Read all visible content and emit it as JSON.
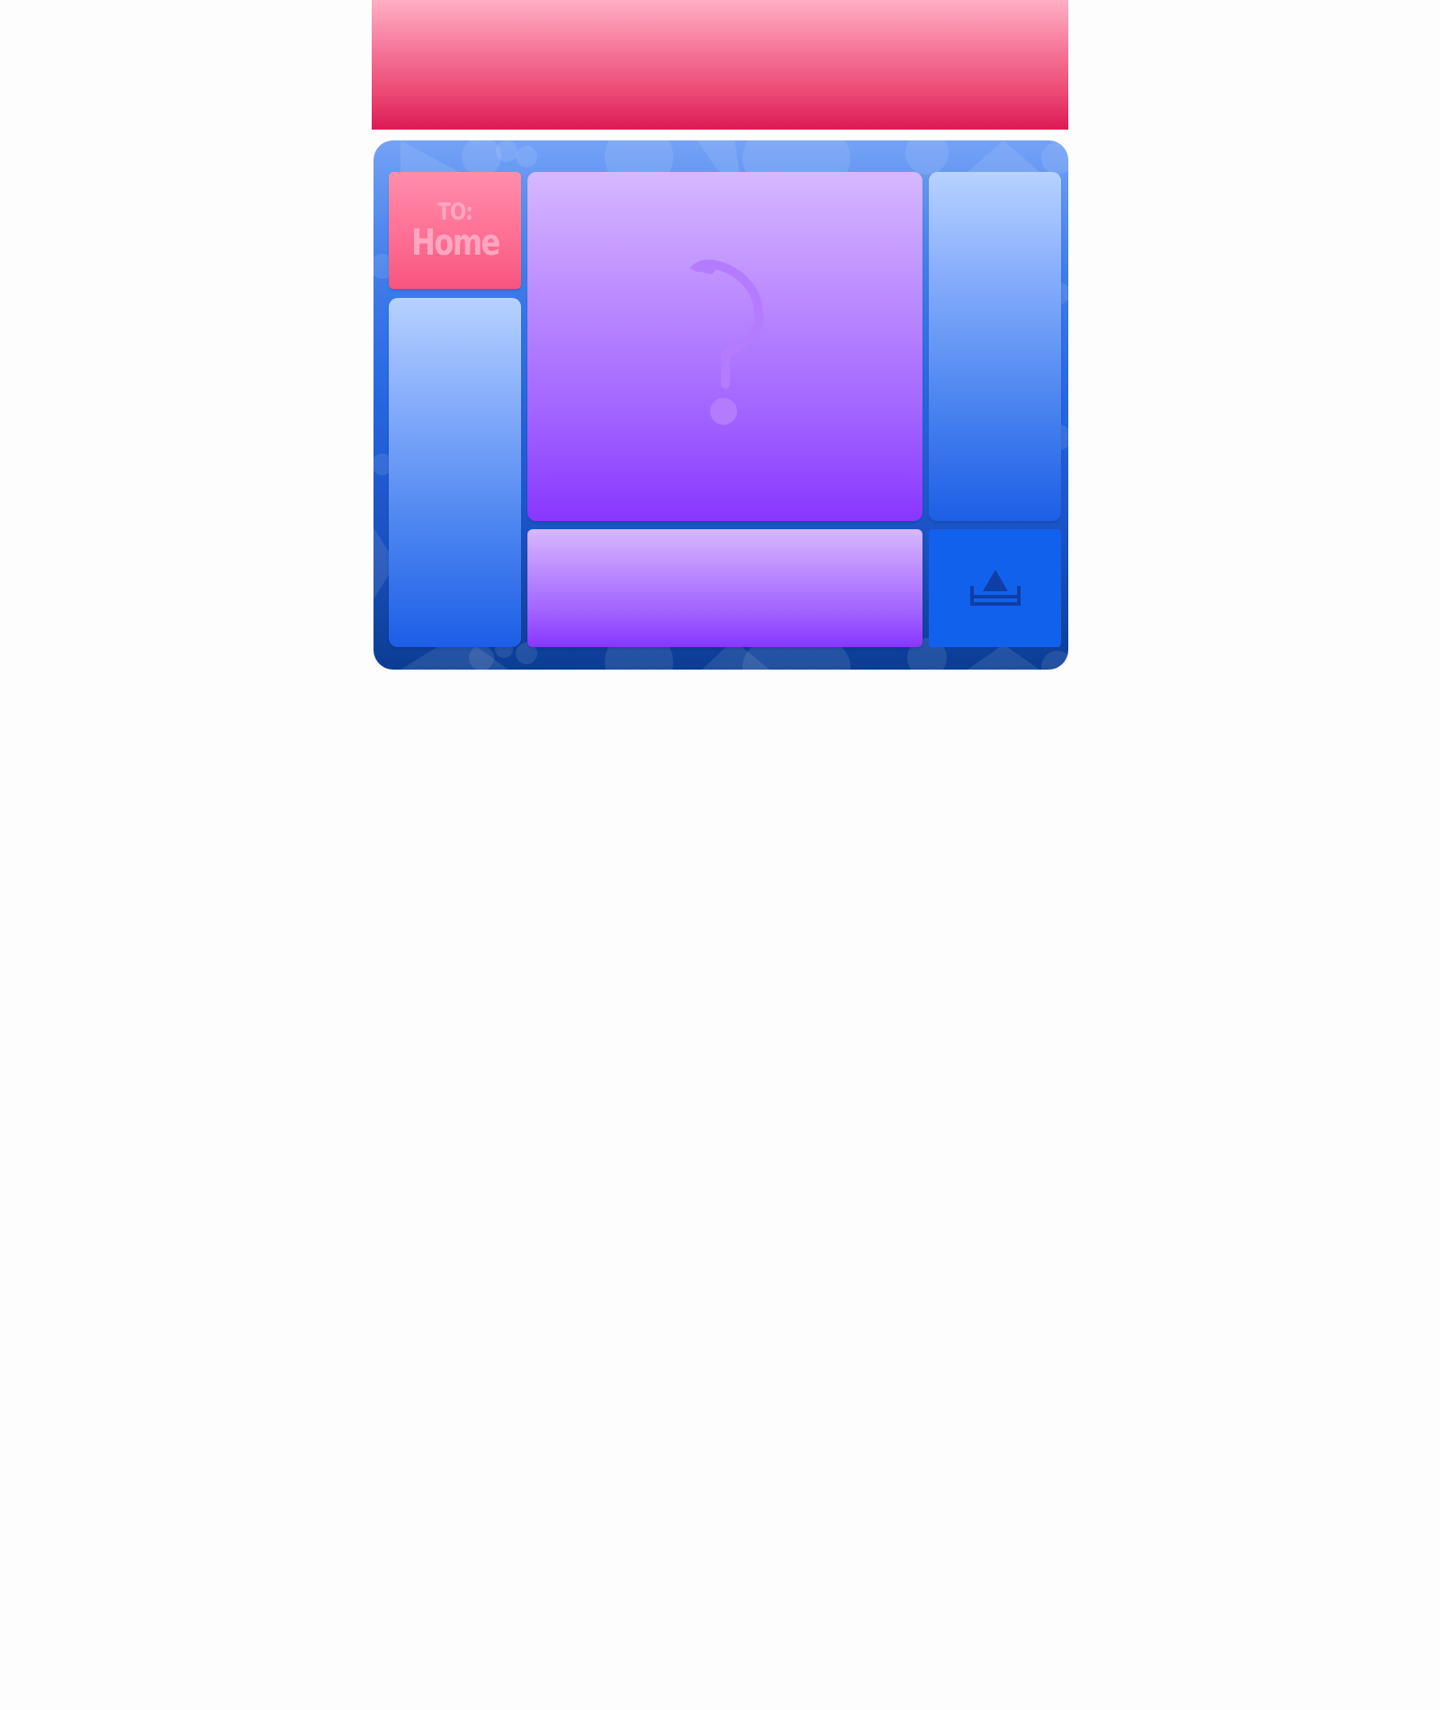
{
  "colors": {
    "banner_top": "#ffafc5",
    "banner_bottom": "#dd1a55",
    "board_top": "#74a2f6",
    "board_bottom": "#0b3d94",
    "destination_tile": "#ff6f94",
    "destination_text": "#ffa7c0",
    "blue_tile_top": "#b7d2ff",
    "blue_tile_bottom": "#1c5ee6",
    "purple_tile_top": "#d6b8ff",
    "purple_tile_bottom": "#8836ff",
    "action_tile": "#1261ed",
    "action_icon": "#0d3fa6",
    "mystery_glyph": "#b47bff"
  },
  "destination": {
    "prefix": "TO:",
    "name": "Home"
  },
  "icons": {
    "mystery": "question-mark-icon",
    "action": "eject-upload-icon",
    "pattern": "card-suits-pattern"
  }
}
